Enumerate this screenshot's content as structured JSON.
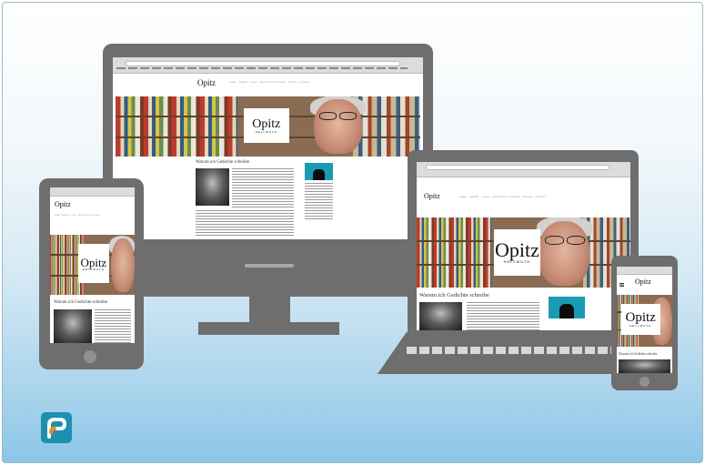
{
  "site": {
    "logo": "Opitz",
    "hero_logo_main": "Opitz",
    "hero_logo_sub": "HELLMUTH",
    "article_title": "Warum ich Gedichte schreibe",
    "nav": [
      "HOME",
      "THEMEN",
      "LESEN",
      "VERÖFFENTLICHUNGEN",
      "PRESSE",
      "KONTAKT"
    ],
    "dropcap": "G",
    "breadcrumb": "Warum ich Gedichte schreibe"
  },
  "colors": {
    "background_top": "#ffffff",
    "background_bottom": "#8cc6e8",
    "device_gray": "#6e6e6e",
    "accent_teal": "#1a9bb5"
  },
  "icons": {
    "brand": "brand-logo-icon"
  }
}
